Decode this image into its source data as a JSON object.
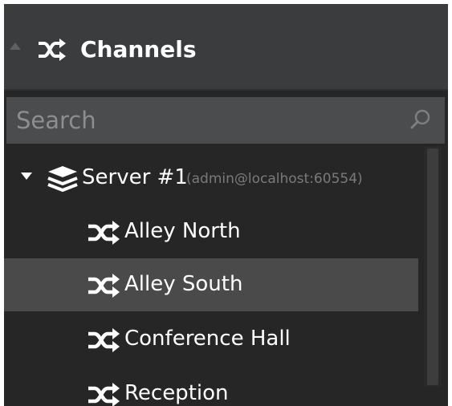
{
  "header": {
    "title": "Channels",
    "icon": "shuffle-icon",
    "collapse_icon": "triangle-up-icon"
  },
  "search": {
    "placeholder": "Search",
    "value": "",
    "icon": "search-icon"
  },
  "tree": {
    "server": {
      "name": "Server #1",
      "detail": "(admin@localhost:60554)",
      "icon": "layers-icon",
      "expanded": true
    },
    "channels": [
      {
        "label": "Alley North",
        "icon": "shuffle-icon",
        "selected": false
      },
      {
        "label": "Alley South",
        "icon": "shuffle-icon",
        "selected": true
      },
      {
        "label": "Conference Hall",
        "icon": "shuffle-icon",
        "selected": false
      },
      {
        "label": "Reception",
        "icon": "shuffle-icon",
        "selected": false
      }
    ]
  },
  "colors": {
    "panel_background": "#262626",
    "header_background": "#3a3c3e",
    "search_background": "#4a4c4e",
    "selected_row": "#4a4a4a",
    "text_primary": "#ffffff",
    "text_secondary": "#7a7a7a"
  }
}
